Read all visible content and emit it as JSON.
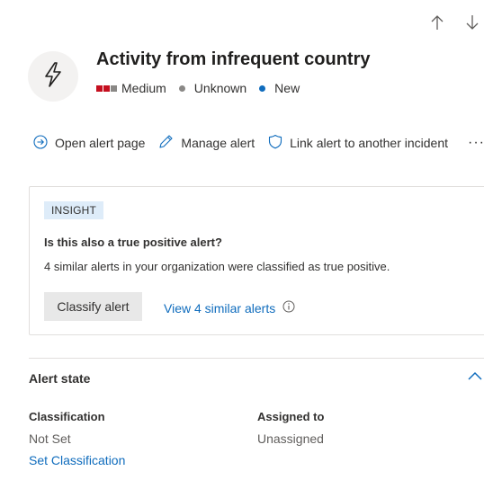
{
  "nav": {
    "up_icon": "arrow-up-icon",
    "down_icon": "arrow-down-icon"
  },
  "alert": {
    "title": "Activity from infrequent country",
    "icon": "lightning-bolt-icon",
    "severity": "Medium",
    "severity_colors": [
      "#c50f1f",
      "#c50f1f",
      "#8a8886"
    ],
    "status": "Unknown",
    "status_color": "#8a8886",
    "state": "New",
    "state_color": "#0f6cbd"
  },
  "commands": {
    "open_alert_page": "Open alert page",
    "manage_alert": "Manage alert",
    "link_alert": "Link alert to another incident",
    "more": "···"
  },
  "insight": {
    "badge": "INSIGHT",
    "question": "Is this also a true positive alert?",
    "text": "4 similar alerts in your organization were classified as true positive.",
    "classify_button": "Classify alert",
    "view_similar_link": "View 4 similar alerts"
  },
  "alert_state": {
    "section_title": "Alert state",
    "classification_label": "Classification",
    "classification_value": "Not Set",
    "set_classification_link": "Set Classification",
    "assigned_label": "Assigned to",
    "assigned_value": "Unassigned"
  }
}
